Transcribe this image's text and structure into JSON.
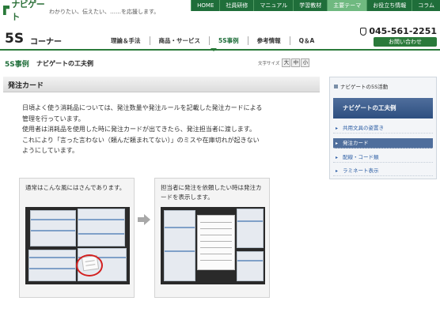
{
  "header": {
    "logo_text": "ナビゲート",
    "tagline": "わかりたい、伝えたい、……を応援します。",
    "nav": [
      {
        "label": "HOME",
        "active": false
      },
      {
        "label": "社員研修",
        "active": false
      },
      {
        "label": "マニュアル",
        "active": false
      },
      {
        "label": "学習教材",
        "active": false
      },
      {
        "label": "主要テーマ",
        "active": true
      },
      {
        "label": "お役立ち情報",
        "active": false
      },
      {
        "label": "コラム",
        "active": false
      }
    ]
  },
  "corner": {
    "title": "5S",
    "subtitle": "コーナー",
    "tabs": [
      {
        "label": "理論＆手法",
        "active": false
      },
      {
        "label": "商品・サービス",
        "active": false
      },
      {
        "label": "5S事例",
        "active": true
      },
      {
        "label": "参考情報",
        "active": false
      },
      {
        "label": "Q＆A",
        "active": false
      }
    ],
    "phone": "045-561-2251",
    "contact_label": "お問い合わせ"
  },
  "page": {
    "category": "5S事例",
    "title": "ナビゲートの工夫例",
    "fontsize_label": "文字サイズ",
    "fontsize_buttons": [
      "大",
      "中",
      "小"
    ]
  },
  "section": {
    "title": "発注カード",
    "paragraphs": [
      "日頃よく使う消耗品については、発注数量や発注ルールを記載した発注カードによる",
      "管理を行っています。",
      "使用者は消耗品を使用した時に発注カードが出てきたら、発注担当者に渡します。",
      "これにより「言った言わない（頼んだ頼まれてない）」のミスや在庫切れが起きない",
      "ようにしています。"
    ],
    "photos": [
      {
        "caption": "通常はこんな風にはさんであります。"
      },
      {
        "caption": "担当者に発注を依頼したい時は発注カードを表示します。"
      }
    ]
  },
  "sidebar": {
    "top_link": "ナビゲートの5S活動",
    "heading": "ナビゲートの工夫例",
    "items": [
      {
        "label": "共用文具の姿置き",
        "active": false
      },
      {
        "label": "発注カード",
        "active": true
      },
      {
        "label": "配線・コード類",
        "active": false
      },
      {
        "label": "ラミネート表示",
        "active": false
      }
    ]
  },
  "colors": {
    "brand_green": "#2a7a3a",
    "sidebar_blue": "#3d5f90",
    "highlight_red": "#d32020"
  }
}
